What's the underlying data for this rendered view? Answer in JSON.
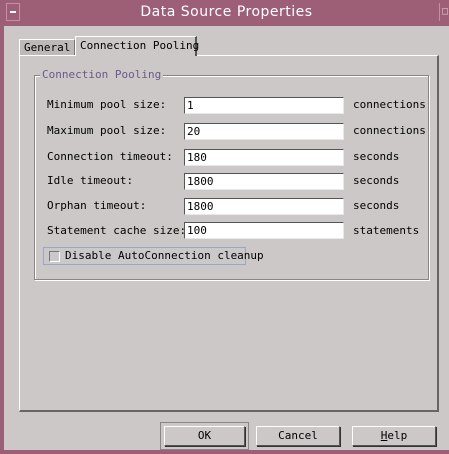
{
  "window": {
    "title": "Data Source Properties"
  },
  "tabs": [
    {
      "label": "General"
    },
    {
      "label": "Connection Pooling"
    }
  ],
  "group": {
    "legend": "Connection Pooling",
    "rows": [
      {
        "label": "Minimum pool size:",
        "value": "1",
        "unit": "connections"
      },
      {
        "label": "Maximum pool size:",
        "value": "20",
        "unit": "connections"
      },
      {
        "label": "Connection timeout:",
        "value": "180",
        "unit": "seconds"
      },
      {
        "label": "Idle timeout:",
        "value": "1800",
        "unit": "seconds"
      },
      {
        "label": "Orphan timeout:",
        "value": "1800",
        "unit": "seconds"
      },
      {
        "label": "Statement cache size:",
        "value": "100",
        "unit": "statements"
      }
    ],
    "checkbox": {
      "label": "Disable AutoConnection cleanup",
      "checked": false
    }
  },
  "buttons": {
    "ok": "OK",
    "cancel": "Cancel",
    "help_first": "H",
    "help_rest": "elp"
  },
  "colors": {
    "titlebar": "#9c5f76",
    "background": "#ccc8c8",
    "legend_text": "#6b5a8a"
  }
}
